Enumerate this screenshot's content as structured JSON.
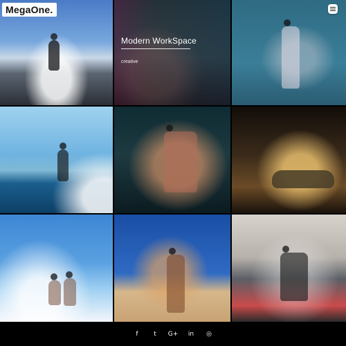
{
  "header": {
    "brand": "MegaOne.",
    "menu_icon": "hamburger-icon"
  },
  "grid": {
    "tiles": [
      {
        "id": "cliff-viewpoint",
        "kind": "photo"
      },
      {
        "id": "modern-workspace",
        "kind": "photo",
        "overlay": {
          "title": "Modern WorkSpace",
          "subtitle": "creative"
        }
      },
      {
        "id": "fashion-portrait",
        "kind": "photo"
      },
      {
        "id": "sailing",
        "kind": "photo"
      },
      {
        "id": "boxer",
        "kind": "photo"
      },
      {
        "id": "vintage-car",
        "kind": "photo"
      },
      {
        "id": "beach-couple",
        "kind": "photo"
      },
      {
        "id": "desert-pose",
        "kind": "photo"
      },
      {
        "id": "gym-workout",
        "kind": "photo"
      }
    ]
  },
  "footer": {
    "social": [
      {
        "label": "f",
        "icon": "facebook-icon"
      },
      {
        "label": "t",
        "icon": "twitter-icon"
      },
      {
        "label": "G+",
        "icon": "google-plus-icon"
      },
      {
        "label": "in",
        "icon": "linkedin-icon"
      },
      {
        "label": "◎",
        "icon": "instagram-icon"
      }
    ]
  }
}
